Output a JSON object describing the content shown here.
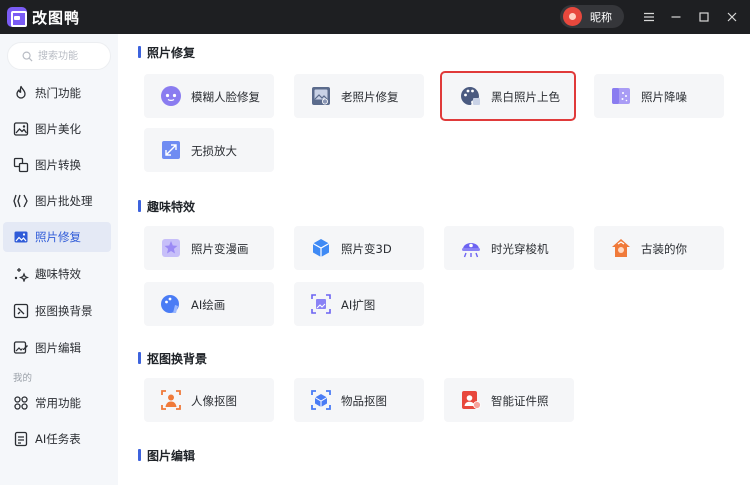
{
  "app": {
    "title": "改图鸭"
  },
  "user": {
    "nickname": "昵称"
  },
  "search": {
    "placeholder": "搜索功能",
    "value": ""
  },
  "sidebar": {
    "items": [
      {
        "label": "热门功能",
        "icon": "flame-icon"
      },
      {
        "label": "图片美化",
        "icon": "image-beautify-icon"
      },
      {
        "label": "图片转换",
        "icon": "image-convert-icon"
      },
      {
        "label": "图片批处理",
        "icon": "batch-icon"
      },
      {
        "label": "照片修复",
        "icon": "photo-repair-icon",
        "active": true
      },
      {
        "label": "趣味特效",
        "icon": "sparkle-icon"
      },
      {
        "label": "抠图换背景",
        "icon": "cutout-icon"
      },
      {
        "label": "图片编辑",
        "icon": "image-edit-icon"
      }
    ],
    "section_mine": "我的",
    "mine_items": [
      {
        "label": "常用功能",
        "icon": "grid-icon"
      },
      {
        "label": "AI任务表",
        "icon": "task-list-icon"
      }
    ]
  },
  "sections": [
    {
      "title": "照片修复",
      "cards": [
        {
          "label": "模糊人脸修复",
          "icon": "face-repair-icon",
          "color": "#8a7cf0"
        },
        {
          "label": "老照片修复",
          "icon": "old-photo-icon",
          "color": "#5b6b8c"
        },
        {
          "label": "黑白照片上色",
          "icon": "palette-icon",
          "color": "#4a5a80",
          "selected": true
        },
        {
          "label": "照片降噪",
          "icon": "denoise-icon",
          "color": "#8a7cf0"
        },
        {
          "label": "无损放大",
          "icon": "enlarge-icon",
          "color": "#6f8cf2"
        }
      ]
    },
    {
      "title": "趣味特效",
      "cards": [
        {
          "label": "照片变漫画",
          "icon": "comic-icon",
          "color": "#9b8af5"
        },
        {
          "label": "照片变3D",
          "icon": "cube-icon",
          "color": "#3f8af5"
        },
        {
          "label": "时光穿梭机",
          "icon": "time-machine-icon",
          "color": "#6c63f2"
        },
        {
          "label": "古装的你",
          "icon": "ancient-costume-icon",
          "color": "#f07a3a"
        },
        {
          "label": "AI绘画",
          "icon": "ai-paint-icon",
          "color": "#4a7cf5"
        },
        {
          "label": "AI扩图",
          "icon": "ai-expand-icon",
          "color": "#6c63f2"
        }
      ]
    },
    {
      "title": "抠图换背景",
      "cards": [
        {
          "label": "人像抠图",
          "icon": "portrait-cutout-icon",
          "color": "#f07a3a"
        },
        {
          "label": "物品抠图",
          "icon": "object-cutout-icon",
          "color": "#4a7cf5"
        },
        {
          "label": "智能证件照",
          "icon": "id-photo-icon",
          "color": "#e8483d"
        }
      ]
    },
    {
      "title": "图片编辑",
      "cards": []
    }
  ]
}
